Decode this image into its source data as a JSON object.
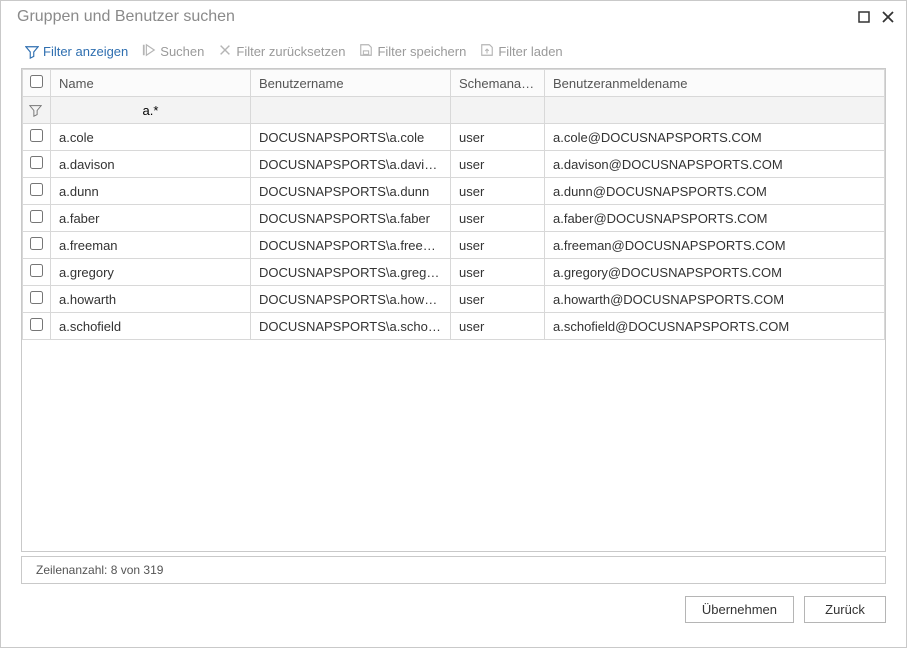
{
  "window": {
    "title": "Gruppen und Benutzer suchen"
  },
  "toolbar": {
    "show_filter": "Filter anzeigen",
    "search": "Suchen",
    "reset": "Filter zurücksetzen",
    "save": "Filter speichern",
    "load": "Filter laden"
  },
  "columns": {
    "name": "Name",
    "username": "Benutzername",
    "schema": "Schemaname",
    "login": "Benutzeranmeldename"
  },
  "filter": {
    "name": "a.*"
  },
  "rows": [
    {
      "name": "a.cole",
      "username": "DOCUSNAPSPORTS\\a.cole",
      "schema": "user",
      "login": "a.cole@DOCUSNAPSPORTS.COM"
    },
    {
      "name": "a.davison",
      "username": "DOCUSNAPSPORTS\\a.davison",
      "schema": "user",
      "login": "a.davison@DOCUSNAPSPORTS.COM"
    },
    {
      "name": "a.dunn",
      "username": "DOCUSNAPSPORTS\\a.dunn",
      "schema": "user",
      "login": "a.dunn@DOCUSNAPSPORTS.COM"
    },
    {
      "name": "a.faber",
      "username": "DOCUSNAPSPORTS\\a.faber",
      "schema": "user",
      "login": "a.faber@DOCUSNAPSPORTS.COM"
    },
    {
      "name": "a.freeman",
      "username": "DOCUSNAPSPORTS\\a.freeman",
      "schema": "user",
      "login": "a.freeman@DOCUSNAPSPORTS.COM"
    },
    {
      "name": "a.gregory",
      "username": "DOCUSNAPSPORTS\\a.gregory",
      "schema": "user",
      "login": "a.gregory@DOCUSNAPSPORTS.COM"
    },
    {
      "name": "a.howarth",
      "username": "DOCUSNAPSPORTS\\a.howarth",
      "schema": "user",
      "login": "a.howarth@DOCUSNAPSPORTS.COM"
    },
    {
      "name": "a.schofield",
      "username": "DOCUSNAPSPORTS\\a.schofield",
      "schema": "user",
      "login": "a.schofield@DOCUSNAPSPORTS.COM"
    }
  ],
  "status": {
    "rowcount": "Zeilenanzahl: 8 von 319"
  },
  "footer": {
    "apply": "Übernehmen",
    "back": "Zurück"
  }
}
